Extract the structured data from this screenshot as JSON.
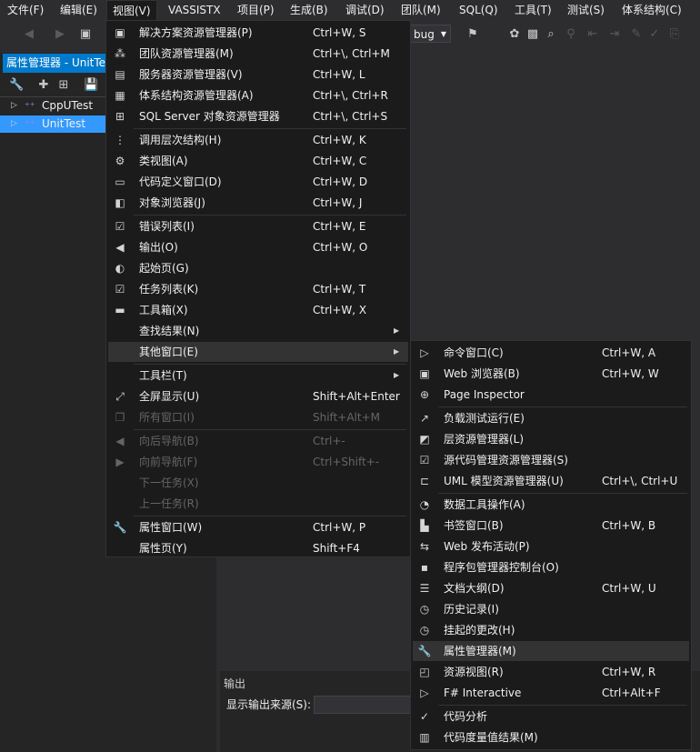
{
  "menubar": [
    "文件(F)",
    "编辑(E)",
    "视图(V)",
    "VASSISTX",
    "项目(P)",
    "生成(B)",
    "调试(D)",
    "团队(M)",
    "SQL(Q)",
    "工具(T)",
    "测试(S)",
    "体系结构(C)"
  ],
  "toolbar": {
    "config": "bug"
  },
  "left_panel": {
    "title": "属性管理器 - UnitTest",
    "tree": [
      {
        "label": "CppUTest",
        "selected": false
      },
      {
        "label": "UnitTest",
        "selected": true
      }
    ]
  },
  "output": {
    "title": "输出",
    "source_label": "显示输出来源(S):"
  },
  "view_menu": [
    {
      "label": "解决方案资源管理器(P)",
      "shortcut": "Ctrl+W, S",
      "icon": "solution-explorer-icon",
      "glyph": "▣"
    },
    {
      "label": "团队资源管理器(M)",
      "shortcut": "Ctrl+\\, Ctrl+M",
      "icon": "team-explorer-icon",
      "glyph": "⁂"
    },
    {
      "label": "服务器资源管理器(V)",
      "shortcut": "Ctrl+W, L",
      "icon": "server-explorer-icon",
      "glyph": "▤"
    },
    {
      "label": "体系结构资源管理器(A)",
      "shortcut": "Ctrl+\\, Ctrl+R",
      "icon": "architecture-explorer-icon",
      "glyph": "▦"
    },
    {
      "label": "SQL Server 对象资源管理器",
      "shortcut": "Ctrl+\\, Ctrl+S",
      "icon": "sql-server-icon",
      "glyph": "⊞"
    },
    {
      "sep": true
    },
    {
      "label": "调用层次结构(H)",
      "shortcut": "Ctrl+W, K",
      "icon": "call-hierarchy-icon",
      "glyph": "⋮"
    },
    {
      "label": "类视图(A)",
      "shortcut": "Ctrl+W, C",
      "icon": "class-view-icon",
      "glyph": "⚙"
    },
    {
      "label": "代码定义窗口(D)",
      "shortcut": "Ctrl+W, D",
      "icon": "code-definition-icon",
      "glyph": "▭"
    },
    {
      "label": "对象浏览器(J)",
      "shortcut": "Ctrl+W, J",
      "icon": "object-browser-icon",
      "glyph": "◧"
    },
    {
      "sep": true
    },
    {
      "label": "错误列表(I)",
      "shortcut": "Ctrl+W, E",
      "icon": "error-list-icon",
      "glyph": "☑"
    },
    {
      "label": "输出(O)",
      "shortcut": "Ctrl+W, O",
      "icon": "output-icon",
      "glyph": "◀"
    },
    {
      "label": "起始页(G)",
      "shortcut": "",
      "icon": "start-page-icon",
      "glyph": "◐"
    },
    {
      "label": "任务列表(K)",
      "shortcut": "Ctrl+W, T",
      "icon": "task-list-icon",
      "glyph": "☑"
    },
    {
      "label": "工具箱(X)",
      "shortcut": "Ctrl+W, X",
      "icon": "toolbox-icon",
      "glyph": "▬"
    },
    {
      "label": "查找结果(N)",
      "shortcut": "",
      "icon": "",
      "glyph": "",
      "submenu": true
    },
    {
      "label": "其他窗口(E)",
      "shortcut": "",
      "icon": "",
      "glyph": "",
      "submenu": true,
      "highlight": true
    },
    {
      "sep": true
    },
    {
      "label": "工具栏(T)",
      "shortcut": "",
      "icon": "",
      "glyph": "",
      "submenu": true
    },
    {
      "label": "全屏显示(U)",
      "shortcut": "Shift+Alt+Enter",
      "icon": "fullscreen-icon",
      "glyph": "⤢"
    },
    {
      "label": "所有窗口(I)",
      "shortcut": "Shift+Alt+M",
      "icon": "all-windows-icon",
      "glyph": "❐",
      "disabled": true
    },
    {
      "sep": true
    },
    {
      "label": "向后导航(B)",
      "shortcut": "Ctrl+-",
      "icon": "navigate-back-icon",
      "glyph": "◀",
      "disabled": true
    },
    {
      "label": "向前导航(F)",
      "shortcut": "Ctrl+Shift+-",
      "icon": "navigate-forward-icon",
      "glyph": "▶",
      "disabled": true
    },
    {
      "label": "下一任务(X)",
      "shortcut": "",
      "icon": "",
      "glyph": "",
      "disabled": true
    },
    {
      "label": "上一任务(R)",
      "shortcut": "",
      "icon": "",
      "glyph": "",
      "disabled": true
    },
    {
      "sep": true
    },
    {
      "label": "属性窗口(W)",
      "shortcut": "Ctrl+W, P",
      "icon": "properties-wrench-icon",
      "glyph": "🔧"
    },
    {
      "label": "属性页(Y)",
      "shortcut": "Shift+F4",
      "icon": "",
      "glyph": ""
    }
  ],
  "other_windows_menu": [
    {
      "label": "命令窗口(C)",
      "shortcut": "Ctrl+W, A",
      "icon": "command-window-icon",
      "glyph": "▷"
    },
    {
      "label": "Web 浏览器(B)",
      "shortcut": "Ctrl+W, W",
      "icon": "web-browser-icon",
      "glyph": "▣"
    },
    {
      "label": "Page Inspector",
      "shortcut": "",
      "icon": "page-inspector-icon",
      "glyph": "⊕"
    },
    {
      "sep": true
    },
    {
      "label": "负载测试运行(E)",
      "shortcut": "",
      "icon": "load-test-icon",
      "glyph": "↗"
    },
    {
      "label": "层资源管理器(L)",
      "shortcut": "",
      "icon": "layer-explorer-icon",
      "glyph": "◩"
    },
    {
      "label": "源代码管理资源管理器(S)",
      "shortcut": "",
      "icon": "source-control-icon",
      "glyph": "☑"
    },
    {
      "label": "UML 模型资源管理器(U)",
      "shortcut": "Ctrl+\\, Ctrl+U",
      "icon": "uml-explorer-icon",
      "glyph": "⊏"
    },
    {
      "sep": true
    },
    {
      "label": "数据工具操作(A)",
      "shortcut": "",
      "icon": "data-tools-icon",
      "glyph": "◔"
    },
    {
      "label": "书签窗口(B)",
      "shortcut": "Ctrl+W, B",
      "icon": "bookmark-icon",
      "glyph": "▙"
    },
    {
      "label": "Web 发布活动(P)",
      "shortcut": "",
      "icon": "web-publish-icon",
      "glyph": "⇆"
    },
    {
      "label": "程序包管理器控制台(O)",
      "shortcut": "",
      "icon": "package-console-icon",
      "glyph": "▪"
    },
    {
      "label": "文档大纲(D)",
      "shortcut": "Ctrl+W, U",
      "icon": "document-outline-icon",
      "glyph": "☰"
    },
    {
      "label": "历史记录(I)",
      "shortcut": "",
      "icon": "history-icon",
      "glyph": "◷"
    },
    {
      "label": "挂起的更改(H)",
      "shortcut": "",
      "icon": "pending-changes-icon",
      "glyph": "◷"
    },
    {
      "label": "属性管理器(M)",
      "shortcut": "",
      "icon": "property-manager-wrench-icon",
      "glyph": "🔧",
      "highlight": true
    },
    {
      "label": "资源视图(R)",
      "shortcut": "Ctrl+W, R",
      "icon": "resource-view-icon",
      "glyph": "◰"
    },
    {
      "label": "F# Interactive",
      "shortcut": "Ctrl+Alt+F",
      "icon": "fsharp-interactive-icon",
      "glyph": "▷"
    },
    {
      "sep": true
    },
    {
      "label": "代码分析",
      "shortcut": "",
      "icon": "code-analysis-icon",
      "glyph": "✓"
    },
    {
      "label": "代码度量值结果(M)",
      "shortcut": "",
      "icon": "code-metrics-icon",
      "glyph": "▥"
    }
  ]
}
